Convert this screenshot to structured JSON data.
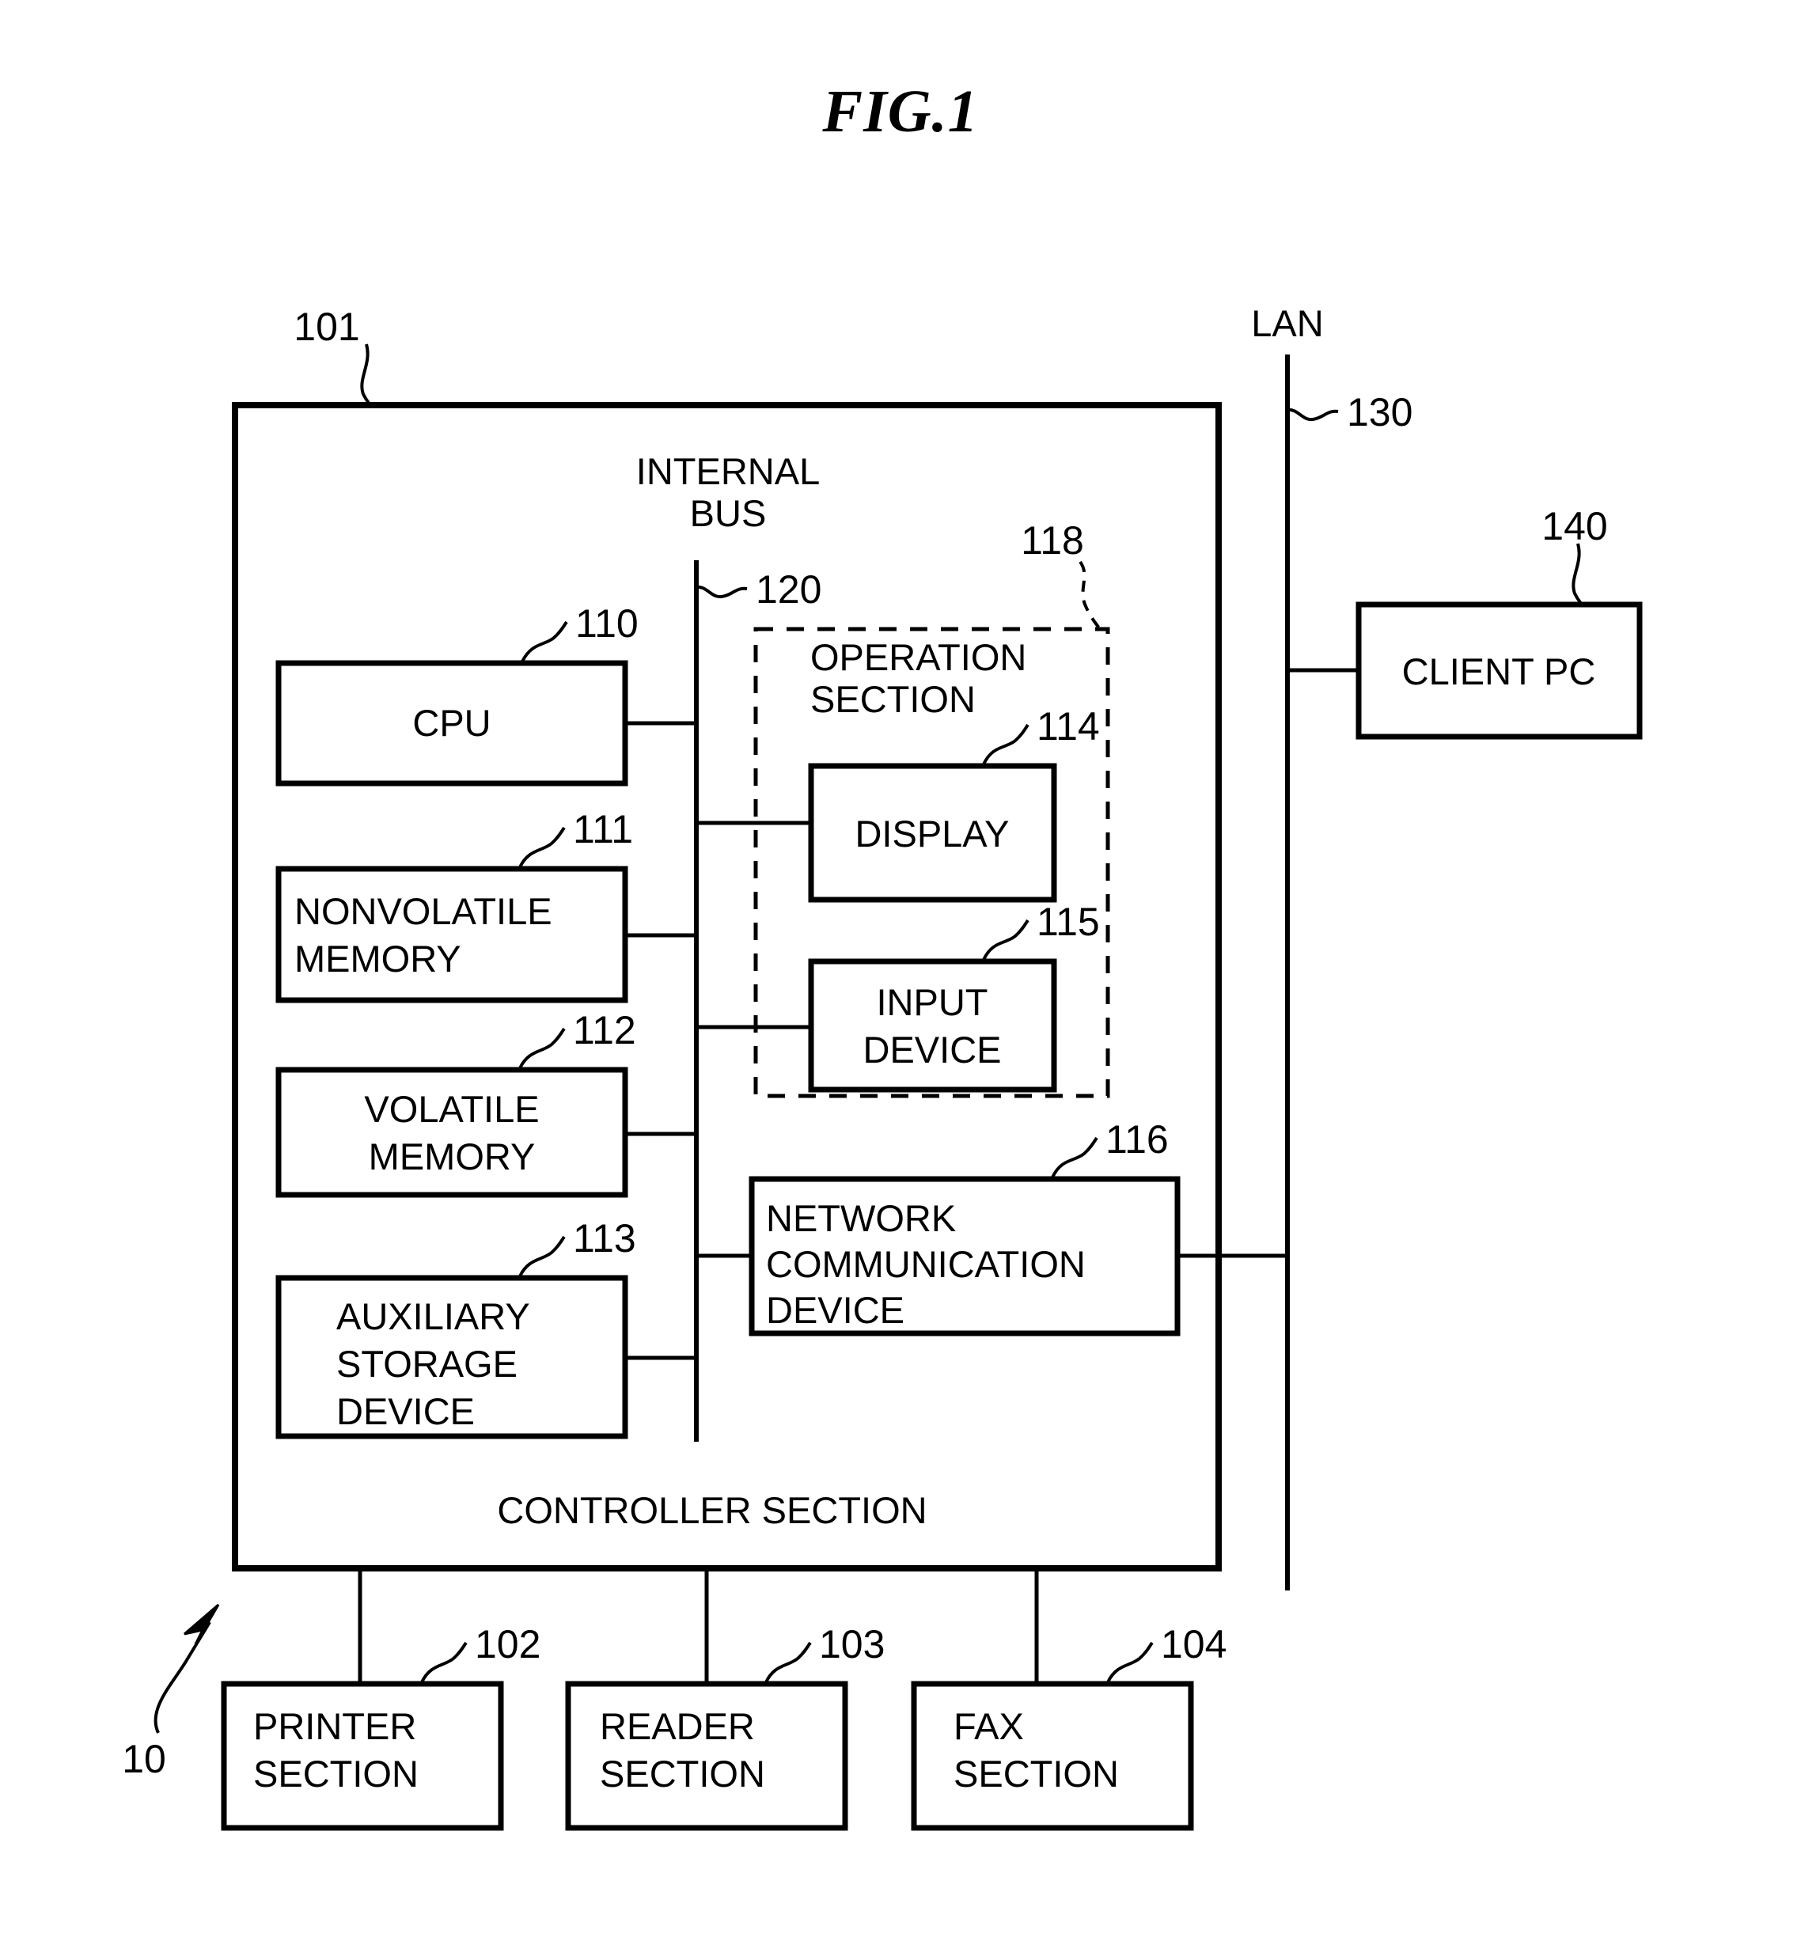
{
  "figure": {
    "title": "FIG.1",
    "system_ref": "10"
  },
  "controller": {
    "ref": "101",
    "label": "CONTROLLER SECTION",
    "bus_label_line1": "INTERNAL",
    "bus_label_line2": "BUS",
    "bus_ref": "120"
  },
  "operation_section": {
    "ref": "118",
    "label_line1": "OPERATION",
    "label_line2": "SECTION",
    "blocks": [
      {
        "ref": "114",
        "label": "DISPLAY"
      },
      {
        "ref": "115",
        "label_line1": "INPUT",
        "label_line2": "DEVICE"
      }
    ]
  },
  "left_blocks": [
    {
      "ref": "110",
      "label": "CPU"
    },
    {
      "ref": "111",
      "label_line1": "NONVOLATILE",
      "label_line2": "MEMORY"
    },
    {
      "ref": "112",
      "label_line1": "VOLATILE",
      "label_line2": "MEMORY"
    },
    {
      "ref": "113",
      "label_line1": "AUXILIARY",
      "label_line2": "STORAGE",
      "label_line3": "DEVICE"
    }
  ],
  "network_device": {
    "ref": "116",
    "label_line1": "NETWORK",
    "label_line2": "COMMUNICATION",
    "label_line3": "DEVICE"
  },
  "network": {
    "lan_label": "LAN",
    "lan_ref": "130",
    "client_pc": {
      "ref": "140",
      "label": "CLIENT PC"
    }
  },
  "bottom_blocks": [
    {
      "ref": "102",
      "label_line1": "PRINTER",
      "label_line2": "SECTION"
    },
    {
      "ref": "103",
      "label_line1": "READER",
      "label_line2": "SECTION"
    },
    {
      "ref": "104",
      "label_line1": "FAX",
      "label_line2": "SECTION"
    }
  ],
  "colors": {
    "ink": "#000000",
    "paper": "#ffffff"
  }
}
